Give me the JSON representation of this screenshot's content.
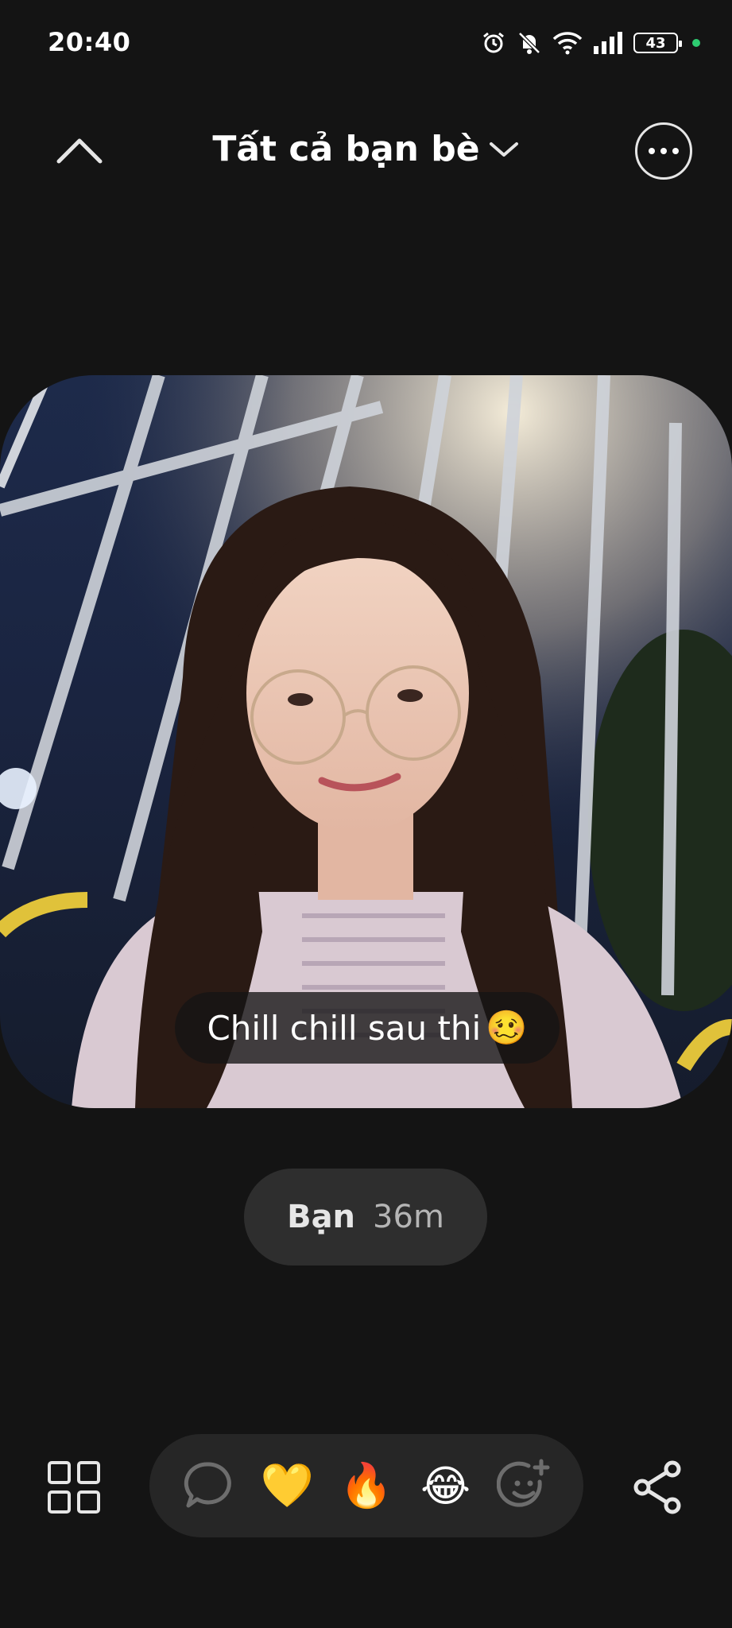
{
  "status_bar": {
    "time": "20:40",
    "battery": "43"
  },
  "header": {
    "title": "Tất cả bạn bè"
  },
  "post": {
    "caption": "Chill chill sau thi",
    "caption_emoji": "🥴",
    "author": "Bạn",
    "time_ago": "36m"
  },
  "reactions": [
    {
      "name": "heart",
      "glyph": "💛"
    },
    {
      "name": "fire",
      "glyph": "🔥"
    },
    {
      "name": "laughing",
      "glyph": "😂"
    }
  ],
  "colors": {
    "background": "#141414",
    "pill": "#2e2e2e",
    "reaction_bar": "#262626",
    "online_dot": "#2ecc71"
  }
}
